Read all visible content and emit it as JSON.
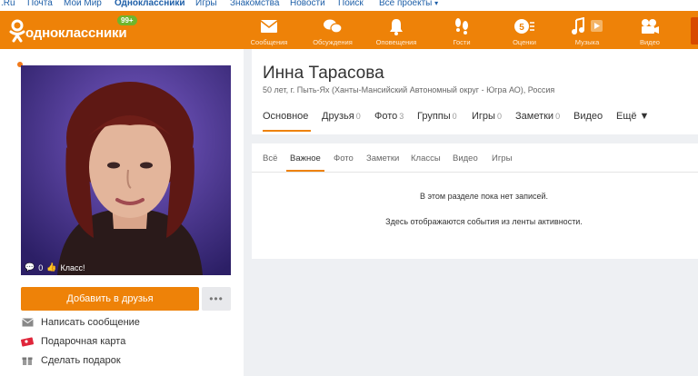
{
  "portal_links": [
    {
      "label": ".Ru"
    },
    {
      "label": "Почта"
    },
    {
      "label": "Мой Мир"
    },
    {
      "label": "Одноклассники"
    },
    {
      "label": "Игры"
    },
    {
      "label": "Знакомства"
    },
    {
      "label": "Новости"
    },
    {
      "label": "Поиск"
    },
    {
      "label": "Все проекты"
    }
  ],
  "brand": {
    "name": "одноклассники",
    "badge": "99+",
    "color": "#ee8208"
  },
  "nav": [
    {
      "label": "Сообщения",
      "icon": "envelope-icon"
    },
    {
      "label": "Обсуждения",
      "icon": "chat-bubbles-icon"
    },
    {
      "label": "Оповещения",
      "icon": "bell-icon"
    },
    {
      "label": "Гости",
      "icon": "footprints-icon"
    },
    {
      "label": "Оценки",
      "icon": "rating-5-icon"
    },
    {
      "label": "Музыка",
      "icon": "music-note-icon"
    },
    {
      "label": "Видео",
      "icon": "video-camera-icon"
    }
  ],
  "photo": {
    "comments": "0",
    "likes_label": "Класс!"
  },
  "buttons": {
    "add_friend": "Добавить в друзья",
    "more": "•••"
  },
  "actions": [
    {
      "label": "Написать сообщение",
      "icon": "envelope-icon"
    },
    {
      "label": "Подарочная карта",
      "icon": "gift-card-icon"
    },
    {
      "label": "Сделать подарок",
      "icon": "gift-icon"
    }
  ],
  "profile": {
    "name": "Инна Тарасова",
    "subtitle": "50 лет, г. Пыть-Ях (Ханты-Мансийский Автономный округ - Югра АО), Россия"
  },
  "profile_tabs": [
    {
      "label": "Основное",
      "count": ""
    },
    {
      "label": "Друзья",
      "count": "0"
    },
    {
      "label": "Фото",
      "count": "3"
    },
    {
      "label": "Группы",
      "count": "0"
    },
    {
      "label": "Игры",
      "count": "0"
    },
    {
      "label": "Заметки",
      "count": "0"
    },
    {
      "label": "Видео",
      "count": ""
    },
    {
      "label": "Ещё ▼",
      "count": ""
    }
  ],
  "feed_tabs": [
    {
      "label": "Всё"
    },
    {
      "label": "Важное"
    },
    {
      "label": "Фото"
    },
    {
      "label": "Заметки"
    },
    {
      "label": "Классы"
    },
    {
      "label": "Видео"
    },
    {
      "label": "Игры"
    }
  ],
  "feed": {
    "empty_title": "В этом разделе пока нет записей.",
    "empty_hint": "Здесь отображаются события из ленты активности."
  }
}
